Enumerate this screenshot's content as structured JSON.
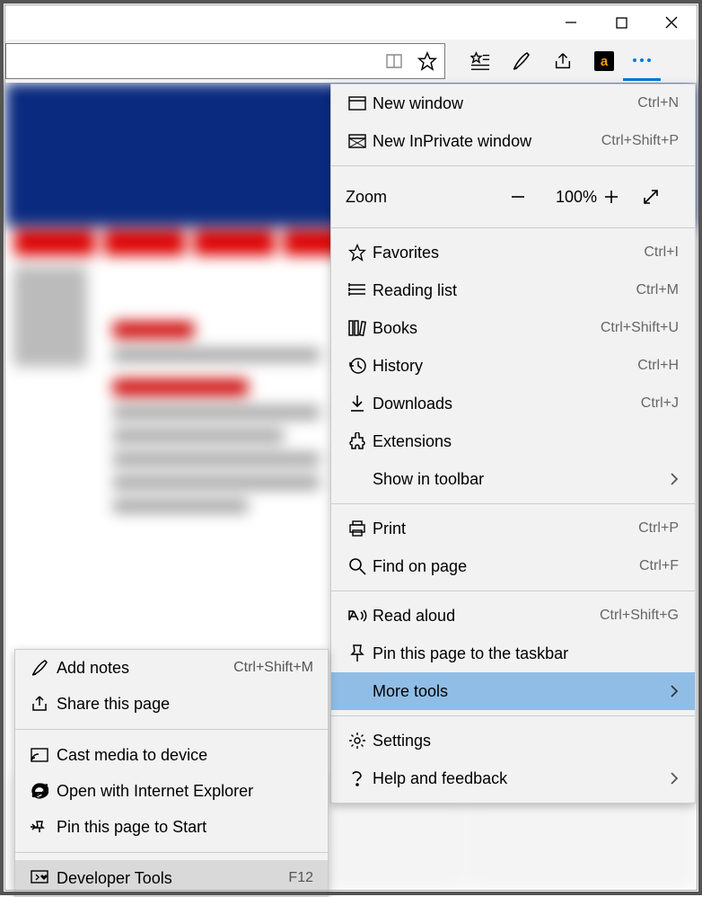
{
  "titlebar": {
    "min": "—",
    "max": "▢",
    "close": "✕"
  },
  "toolbar": {
    "more_dots": "⋯"
  },
  "zoom": {
    "label": "Zoom",
    "value": "100%"
  },
  "main_menu": {
    "new_window": {
      "label": "New window",
      "shortcut": "Ctrl+N"
    },
    "new_inprivate": {
      "label": "New InPrivate window",
      "shortcut": "Ctrl+Shift+P"
    },
    "favorites": {
      "label": "Favorites",
      "shortcut": "Ctrl+I"
    },
    "reading_list": {
      "label": "Reading list",
      "shortcut": "Ctrl+M"
    },
    "books": {
      "label": "Books",
      "shortcut": "Ctrl+Shift+U"
    },
    "history": {
      "label": "History",
      "shortcut": "Ctrl+H"
    },
    "downloads": {
      "label": "Downloads",
      "shortcut": "Ctrl+J"
    },
    "extensions": {
      "label": "Extensions",
      "shortcut": ""
    },
    "show_toolbar": {
      "label": "Show in toolbar",
      "shortcut": ""
    },
    "print": {
      "label": "Print",
      "shortcut": "Ctrl+P"
    },
    "find": {
      "label": "Find on page",
      "shortcut": "Ctrl+F"
    },
    "read_aloud": {
      "label": "Read aloud",
      "shortcut": "Ctrl+Shift+G"
    },
    "pin_taskbar": {
      "label": "Pin this page to the taskbar",
      "shortcut": ""
    },
    "more_tools": {
      "label": "More tools",
      "shortcut": ""
    },
    "settings": {
      "label": "Settings",
      "shortcut": ""
    },
    "help": {
      "label": "Help and feedback",
      "shortcut": ""
    }
  },
  "sub_menu": {
    "add_notes": {
      "label": "Add notes",
      "shortcut": "Ctrl+Shift+M"
    },
    "share": {
      "label": "Share this page",
      "shortcut": ""
    },
    "cast": {
      "label": "Cast media to device",
      "shortcut": ""
    },
    "open_ie": {
      "label": "Open with Internet Explorer",
      "shortcut": ""
    },
    "pin_start": {
      "label": "Pin this page to Start",
      "shortcut": ""
    },
    "dev_tools": {
      "label": "Developer Tools",
      "shortcut": "F12"
    }
  }
}
